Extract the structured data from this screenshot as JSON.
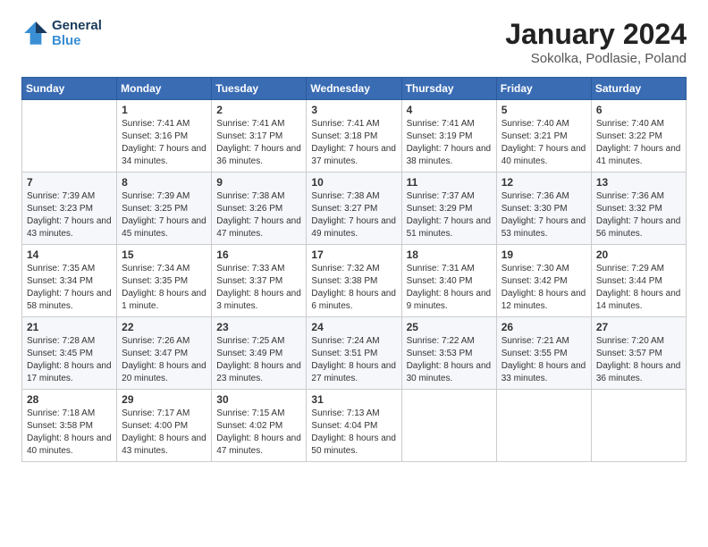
{
  "header": {
    "logo_line1": "General",
    "logo_line2": "Blue",
    "month_title": "January 2024",
    "location": "Sokolka, Podlasie, Poland"
  },
  "weekdays": [
    "Sunday",
    "Monday",
    "Tuesday",
    "Wednesday",
    "Thursday",
    "Friday",
    "Saturday"
  ],
  "weeks": [
    [
      {
        "day": "",
        "sunrise": "",
        "sunset": "",
        "daylight": ""
      },
      {
        "day": "1",
        "sunrise": "Sunrise: 7:41 AM",
        "sunset": "Sunset: 3:16 PM",
        "daylight": "Daylight: 7 hours and 34 minutes."
      },
      {
        "day": "2",
        "sunrise": "Sunrise: 7:41 AM",
        "sunset": "Sunset: 3:17 PM",
        "daylight": "Daylight: 7 hours and 36 minutes."
      },
      {
        "day": "3",
        "sunrise": "Sunrise: 7:41 AM",
        "sunset": "Sunset: 3:18 PM",
        "daylight": "Daylight: 7 hours and 37 minutes."
      },
      {
        "day": "4",
        "sunrise": "Sunrise: 7:41 AM",
        "sunset": "Sunset: 3:19 PM",
        "daylight": "Daylight: 7 hours and 38 minutes."
      },
      {
        "day": "5",
        "sunrise": "Sunrise: 7:40 AM",
        "sunset": "Sunset: 3:21 PM",
        "daylight": "Daylight: 7 hours and 40 minutes."
      },
      {
        "day": "6",
        "sunrise": "Sunrise: 7:40 AM",
        "sunset": "Sunset: 3:22 PM",
        "daylight": "Daylight: 7 hours and 41 minutes."
      }
    ],
    [
      {
        "day": "7",
        "sunrise": "Sunrise: 7:39 AM",
        "sunset": "Sunset: 3:23 PM",
        "daylight": "Daylight: 7 hours and 43 minutes."
      },
      {
        "day": "8",
        "sunrise": "Sunrise: 7:39 AM",
        "sunset": "Sunset: 3:25 PM",
        "daylight": "Daylight: 7 hours and 45 minutes."
      },
      {
        "day": "9",
        "sunrise": "Sunrise: 7:38 AM",
        "sunset": "Sunset: 3:26 PM",
        "daylight": "Daylight: 7 hours and 47 minutes."
      },
      {
        "day": "10",
        "sunrise": "Sunrise: 7:38 AM",
        "sunset": "Sunset: 3:27 PM",
        "daylight": "Daylight: 7 hours and 49 minutes."
      },
      {
        "day": "11",
        "sunrise": "Sunrise: 7:37 AM",
        "sunset": "Sunset: 3:29 PM",
        "daylight": "Daylight: 7 hours and 51 minutes."
      },
      {
        "day": "12",
        "sunrise": "Sunrise: 7:36 AM",
        "sunset": "Sunset: 3:30 PM",
        "daylight": "Daylight: 7 hours and 53 minutes."
      },
      {
        "day": "13",
        "sunrise": "Sunrise: 7:36 AM",
        "sunset": "Sunset: 3:32 PM",
        "daylight": "Daylight: 7 hours and 56 minutes."
      }
    ],
    [
      {
        "day": "14",
        "sunrise": "Sunrise: 7:35 AM",
        "sunset": "Sunset: 3:34 PM",
        "daylight": "Daylight: 7 hours and 58 minutes."
      },
      {
        "day": "15",
        "sunrise": "Sunrise: 7:34 AM",
        "sunset": "Sunset: 3:35 PM",
        "daylight": "Daylight: 8 hours and 1 minute."
      },
      {
        "day": "16",
        "sunrise": "Sunrise: 7:33 AM",
        "sunset": "Sunset: 3:37 PM",
        "daylight": "Daylight: 8 hours and 3 minutes."
      },
      {
        "day": "17",
        "sunrise": "Sunrise: 7:32 AM",
        "sunset": "Sunset: 3:38 PM",
        "daylight": "Daylight: 8 hours and 6 minutes."
      },
      {
        "day": "18",
        "sunrise": "Sunrise: 7:31 AM",
        "sunset": "Sunset: 3:40 PM",
        "daylight": "Daylight: 8 hours and 9 minutes."
      },
      {
        "day": "19",
        "sunrise": "Sunrise: 7:30 AM",
        "sunset": "Sunset: 3:42 PM",
        "daylight": "Daylight: 8 hours and 12 minutes."
      },
      {
        "day": "20",
        "sunrise": "Sunrise: 7:29 AM",
        "sunset": "Sunset: 3:44 PM",
        "daylight": "Daylight: 8 hours and 14 minutes."
      }
    ],
    [
      {
        "day": "21",
        "sunrise": "Sunrise: 7:28 AM",
        "sunset": "Sunset: 3:45 PM",
        "daylight": "Daylight: 8 hours and 17 minutes."
      },
      {
        "day": "22",
        "sunrise": "Sunrise: 7:26 AM",
        "sunset": "Sunset: 3:47 PM",
        "daylight": "Daylight: 8 hours and 20 minutes."
      },
      {
        "day": "23",
        "sunrise": "Sunrise: 7:25 AM",
        "sunset": "Sunset: 3:49 PM",
        "daylight": "Daylight: 8 hours and 23 minutes."
      },
      {
        "day": "24",
        "sunrise": "Sunrise: 7:24 AM",
        "sunset": "Sunset: 3:51 PM",
        "daylight": "Daylight: 8 hours and 27 minutes."
      },
      {
        "day": "25",
        "sunrise": "Sunrise: 7:22 AM",
        "sunset": "Sunset: 3:53 PM",
        "daylight": "Daylight: 8 hours and 30 minutes."
      },
      {
        "day": "26",
        "sunrise": "Sunrise: 7:21 AM",
        "sunset": "Sunset: 3:55 PM",
        "daylight": "Daylight: 8 hours and 33 minutes."
      },
      {
        "day": "27",
        "sunrise": "Sunrise: 7:20 AM",
        "sunset": "Sunset: 3:57 PM",
        "daylight": "Daylight: 8 hours and 36 minutes."
      }
    ],
    [
      {
        "day": "28",
        "sunrise": "Sunrise: 7:18 AM",
        "sunset": "Sunset: 3:58 PM",
        "daylight": "Daylight: 8 hours and 40 minutes."
      },
      {
        "day": "29",
        "sunrise": "Sunrise: 7:17 AM",
        "sunset": "Sunset: 4:00 PM",
        "daylight": "Daylight: 8 hours and 43 minutes."
      },
      {
        "day": "30",
        "sunrise": "Sunrise: 7:15 AM",
        "sunset": "Sunset: 4:02 PM",
        "daylight": "Daylight: 8 hours and 47 minutes."
      },
      {
        "day": "31",
        "sunrise": "Sunrise: 7:13 AM",
        "sunset": "Sunset: 4:04 PM",
        "daylight": "Daylight: 8 hours and 50 minutes."
      },
      {
        "day": "",
        "sunrise": "",
        "sunset": "",
        "daylight": ""
      },
      {
        "day": "",
        "sunrise": "",
        "sunset": "",
        "daylight": ""
      },
      {
        "day": "",
        "sunrise": "",
        "sunset": "",
        "daylight": ""
      }
    ]
  ]
}
